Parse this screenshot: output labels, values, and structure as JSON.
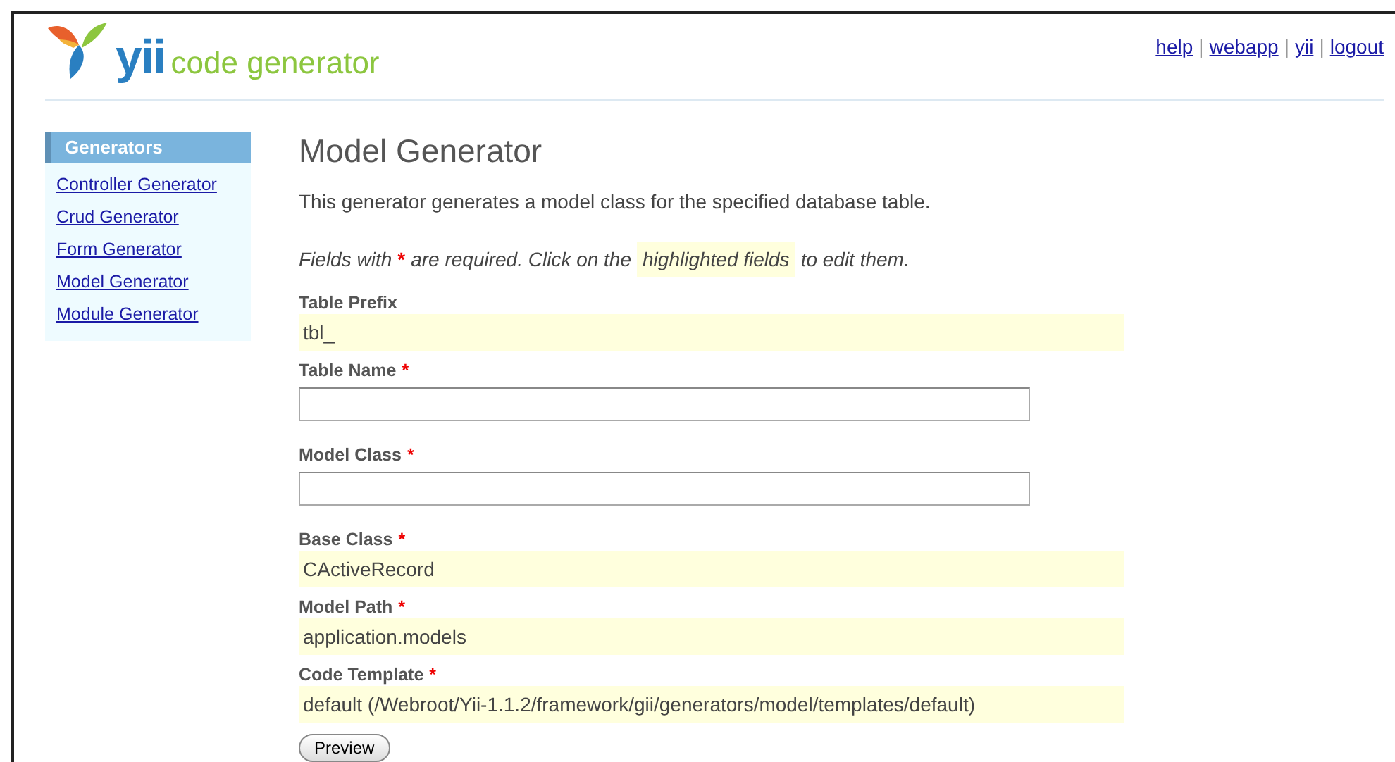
{
  "header": {
    "logo_word": "yii",
    "logo_subtitle": "code generator",
    "links": [
      {
        "label": "help"
      },
      {
        "label": "webapp"
      },
      {
        "label": "yii"
      },
      {
        "label": "logout"
      }
    ],
    "separator": "|"
  },
  "sidebar": {
    "title": "Generators",
    "items": [
      {
        "label": "Controller Generator"
      },
      {
        "label": "Crud Generator"
      },
      {
        "label": "Form Generator"
      },
      {
        "label": "Model Generator"
      },
      {
        "label": "Module Generator"
      }
    ]
  },
  "content": {
    "title": "Model Generator",
    "description": "This generator generates a model class for the specified database table.",
    "note": {
      "before": "Fields with",
      "mark": "*",
      "middle": "are required. Click on the",
      "highlight": "highlighted fields",
      "after": "to edit them."
    },
    "fields": [
      {
        "label": "Table Prefix",
        "required": false,
        "kind": "sticky",
        "value": "tbl_"
      },
      {
        "label": "Table Name",
        "required": true,
        "kind": "input"
      },
      {
        "label": "Model Class",
        "required": true,
        "kind": "input"
      },
      {
        "label": "Base Class",
        "required": true,
        "kind": "sticky",
        "value": "CActiveRecord"
      },
      {
        "label": "Model Path",
        "required": true,
        "kind": "sticky",
        "value": "application.models"
      },
      {
        "label": "Code Template",
        "required": true,
        "kind": "sticky",
        "value": "default (/Webroot/Yii-1.1.2/framework/gii/generators/model/templates/default)"
      }
    ],
    "button": "Preview"
  }
}
